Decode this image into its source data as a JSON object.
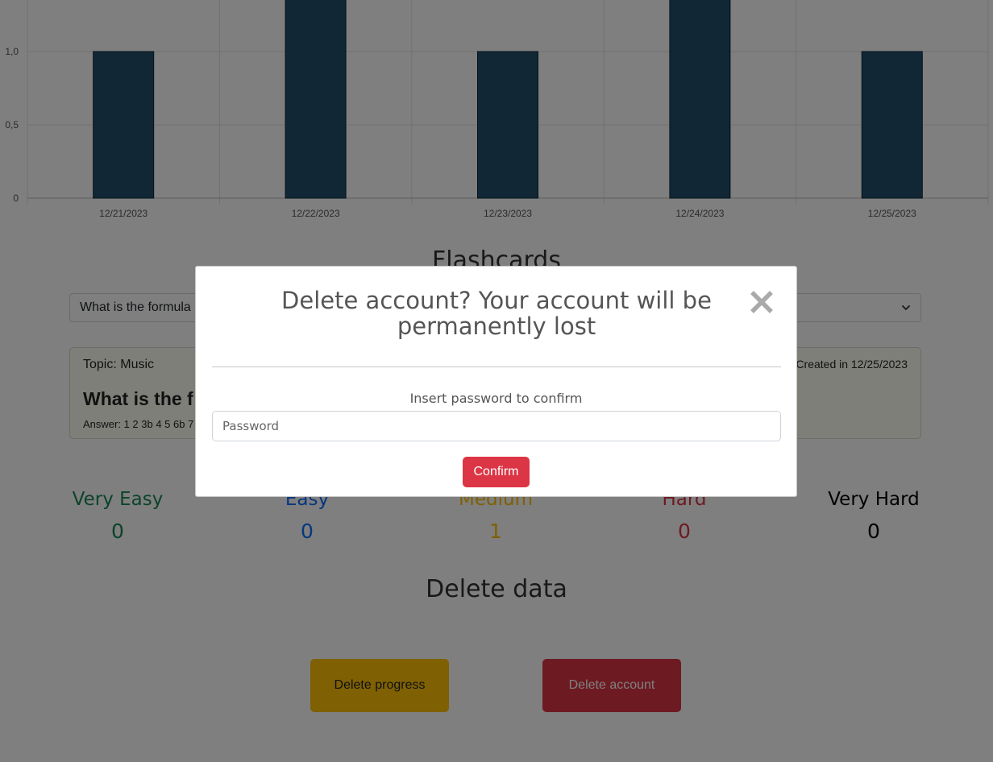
{
  "chart_data": {
    "type": "bar",
    "categories": [
      "12/21/2023",
      "12/22/2023",
      "12/23/2023",
      "12/24/2023",
      "12/25/2023"
    ],
    "values": [
      1,
      2,
      1,
      2,
      1
    ],
    "y_ticks": [
      "0",
      "0,5",
      "1,0"
    ],
    "ylim": [
      0,
      1.35
    ],
    "grid": true,
    "bar_color": "#234f6d"
  },
  "flashcards": {
    "title": "Flashcards",
    "selected_question": "What is the formula",
    "card": {
      "topic": "Topic: Music",
      "created": "Created in 12/25/2023",
      "question": "What is the f",
      "answer": "Answer: 1 2 3b 4 5 6b 7"
    }
  },
  "difficulty": [
    {
      "label": "Very Easy",
      "count": "0",
      "color": "#198754"
    },
    {
      "label": "Easy",
      "count": "0",
      "color": "#0d6efd"
    },
    {
      "label": "Medium",
      "count": "1",
      "color": "#ffc107"
    },
    {
      "label": "Hard",
      "count": "0",
      "color": "#dc3545"
    },
    {
      "label": "Very Hard",
      "count": "0",
      "color": "#000000"
    }
  ],
  "delete_section": {
    "title": "Delete data",
    "progress_button": "Delete progress",
    "account_button": "Delete account"
  },
  "modal": {
    "title": "Delete account? Your account will be permanently lost",
    "close_icon": "close-icon",
    "prompt": "Insert password to confirm",
    "password_placeholder": "Password",
    "confirm_label": "Confirm"
  }
}
